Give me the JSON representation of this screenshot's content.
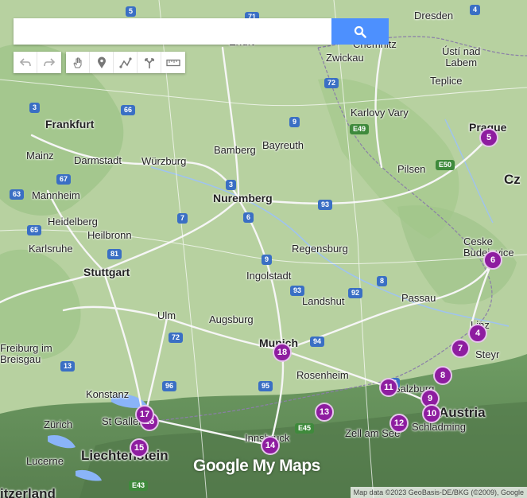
{
  "search": {
    "placeholder": "",
    "value": ""
  },
  "toolbar": {
    "undo": "undo-icon",
    "redo": "redo-icon",
    "pan": "hand-icon",
    "marker": "pin-icon",
    "line": "draw-line-icon",
    "directions": "directions-icon",
    "measure": "ruler-icon"
  },
  "cities": [
    {
      "name": "Dresden",
      "big": false
    },
    {
      "name": "Zwickau",
      "big": false
    },
    {
      "name": "Chemnitz",
      "big": false
    },
    {
      "name": "Erfurt",
      "big": false
    },
    {
      "name": "Ústí nad\nLabem",
      "big": false
    },
    {
      "name": "Teplice",
      "big": false
    },
    {
      "name": "Karlovy Vary",
      "big": false
    },
    {
      "name": "Prague",
      "big": true
    },
    {
      "name": "Frankfurt",
      "big": true
    },
    {
      "name": "Mainz",
      "big": false
    },
    {
      "name": "Darmstadt",
      "big": false
    },
    {
      "name": "Würzburg",
      "big": false
    },
    {
      "name": "Bamberg",
      "big": false
    },
    {
      "name": "Bayreuth",
      "big": false
    },
    {
      "name": "Nuremberg",
      "big": true
    },
    {
      "name": "Pilsen",
      "big": false
    },
    {
      "name": "Mannheim",
      "big": false
    },
    {
      "name": "Heidelberg",
      "big": false
    },
    {
      "name": "Heilbronn",
      "big": false
    },
    {
      "name": "Karlsruhe",
      "big": false
    },
    {
      "name": "Stuttgart",
      "big": true
    },
    {
      "name": "Regensburg",
      "big": false
    },
    {
      "name": "Ingolstadt",
      "big": false
    },
    {
      "name": "Ceske\nBudejovice",
      "big": false
    },
    {
      "name": "Landshut",
      "big": false
    },
    {
      "name": "Passau",
      "big": false
    },
    {
      "name": "Ulm",
      "big": false
    },
    {
      "name": "Augsburg",
      "big": false
    },
    {
      "name": "Munich",
      "big": true
    },
    {
      "name": "Linz",
      "big": false
    },
    {
      "name": "Steyr",
      "big": false
    },
    {
      "name": "Freiburg im\nBreisgau",
      "big": false
    },
    {
      "name": "Rosenheim",
      "big": false
    },
    {
      "name": "Konstanz",
      "big": false
    },
    {
      "name": "Salzburg",
      "big": false
    },
    {
      "name": "Zürich",
      "big": false
    },
    {
      "name": "St Gallen",
      "big": false
    },
    {
      "name": "Schladming",
      "big": false
    },
    {
      "name": "Zell am See",
      "big": false
    },
    {
      "name": "Innsbruck",
      "big": false
    },
    {
      "name": "Lucerne",
      "big": false
    },
    {
      "name": "Liechtenstein",
      "big": true
    }
  ],
  "countries": [
    {
      "name": "Austria"
    },
    {
      "name": "Cz"
    },
    {
      "name": "itzerland"
    }
  ],
  "roads": [
    "4",
    "71",
    "72",
    "9",
    "E49",
    "E50",
    "5",
    "66",
    "3",
    "67",
    "63",
    "7",
    "6",
    "93",
    "65",
    "81",
    "3",
    "93",
    "92",
    "8",
    "9",
    "94",
    "96",
    "95",
    "8",
    "E45",
    "E43",
    "72",
    "13"
  ],
  "markers": [
    {
      "label": "4"
    },
    {
      "label": "5"
    },
    {
      "label": "6"
    },
    {
      "label": "7"
    },
    {
      "label": "8"
    },
    {
      "label": "9"
    },
    {
      "label": "10"
    },
    {
      "label": "11"
    },
    {
      "label": "12"
    },
    {
      "label": "13"
    },
    {
      "label": "14"
    },
    {
      "label": "15"
    },
    {
      "label": "16"
    },
    {
      "label": "17"
    },
    {
      "label": "18"
    }
  ],
  "watermark": "Google My Maps",
  "attribution": "Map data ©2023 GeoBasis-DE/BKG (©2009), Google"
}
